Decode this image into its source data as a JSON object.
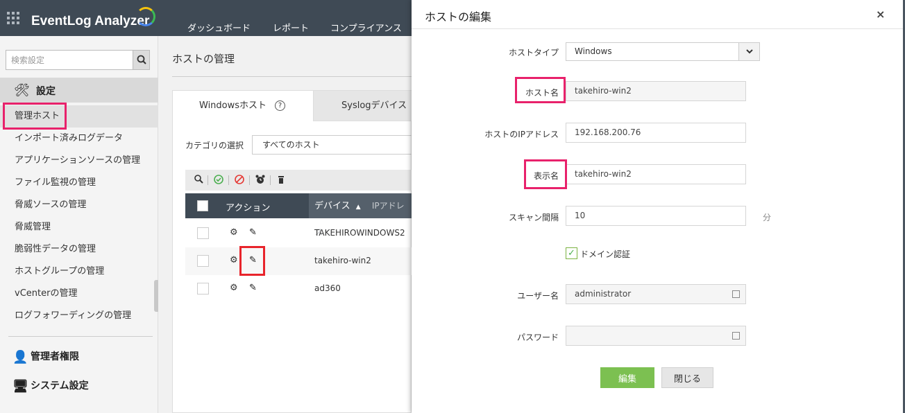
{
  "header": {
    "brand": "EventLog Analyzer",
    "nav": [
      "ダッシュボード",
      "レポート",
      "コンプライアンス"
    ]
  },
  "sidebar": {
    "search_placeholder": "検索設定",
    "settings_title": "設定",
    "items": [
      {
        "label": "管理ホスト",
        "active": true
      },
      {
        "label": "インポート済みログデータ"
      },
      {
        "label": "アプリケーションソースの管理"
      },
      {
        "label": "ファイル監視の管理"
      },
      {
        "label": "脅威ソースの管理"
      },
      {
        "label": "脅威管理"
      },
      {
        "label": "脆弱性データの管理"
      },
      {
        "label": "ホストグループの管理"
      },
      {
        "label": "vCenterの管理"
      },
      {
        "label": "ログフォワーディングの管理"
      }
    ],
    "groups": [
      {
        "label": "管理者権限"
      },
      {
        "label": "システム設定"
      }
    ]
  },
  "main": {
    "title": "ホストの管理",
    "tabs": [
      "Windowsホスト",
      "Syslogデバイス"
    ],
    "help_glyph": "?",
    "category_label": "カテゴリの選択",
    "category_value": "すべてのホスト",
    "columns": {
      "action": "アクション",
      "device": "デバイス",
      "sort_glyph": "▲",
      "ip": "IPアドレス"
    },
    "rows": [
      {
        "name": "TAKEHIROWINDOWS2"
      },
      {
        "name": "takehiro-win2"
      },
      {
        "name": "ad360"
      }
    ]
  },
  "modal": {
    "title": "ホストの編集",
    "close": "×",
    "fields": {
      "host_type": {
        "label": "ホストタイプ",
        "value": "Windows"
      },
      "host_name": {
        "label": "ホスト名",
        "value": "takehiro-win2"
      },
      "ip": {
        "label": "ホストのIPアドレス",
        "value": "192.168.200.76"
      },
      "display_name": {
        "label": "表示名",
        "value": "takehiro-win2"
      },
      "scan_interval": {
        "label": "スキャン間隔",
        "value": "10",
        "unit": "分"
      },
      "domain_auth": {
        "label": "ドメイン認証",
        "checked": true
      },
      "username": {
        "label": "ユーザー名",
        "value": "administrator"
      },
      "password": {
        "label": "パスワード",
        "value": ""
      }
    },
    "buttons": {
      "edit": "編集",
      "close": "閉じる"
    }
  },
  "colors": {
    "topbar": "#3f4a55",
    "highlight": "#e8216b",
    "highlight_red": "#e8242b",
    "primary_button": "#7cc051"
  }
}
